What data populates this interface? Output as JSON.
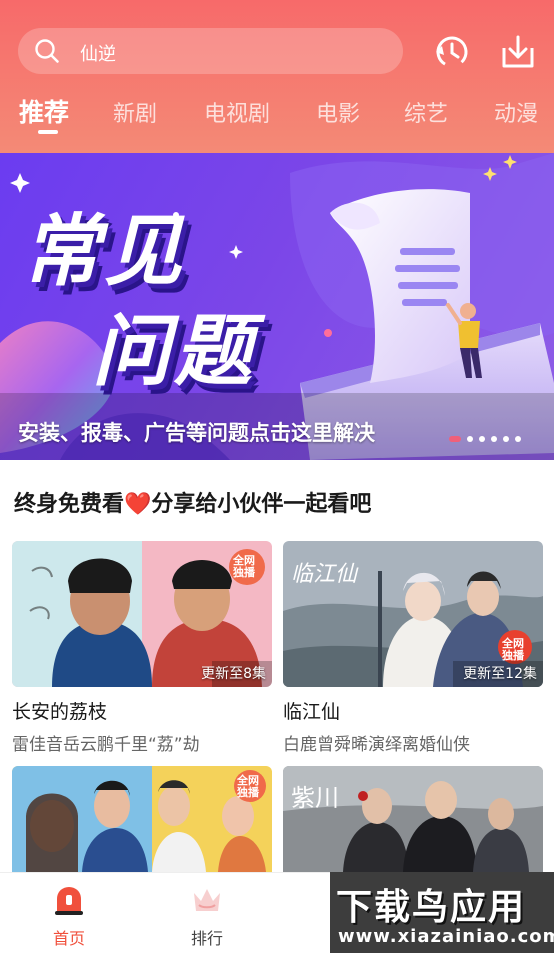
{
  "header": {
    "search_query": "仙逆",
    "icons": [
      "search-icon",
      "history-icon",
      "download-icon"
    ],
    "accent_color": "#f76a6a"
  },
  "tabs": [
    {
      "label": "推荐",
      "active": true
    },
    {
      "label": "新剧",
      "active": false
    },
    {
      "label": "电视剧",
      "active": false
    },
    {
      "label": "电影",
      "active": false
    },
    {
      "label": "综艺",
      "active": false
    },
    {
      "label": "动漫",
      "active": false
    }
  ],
  "banner": {
    "title_line1": "常见",
    "title_line2": "问题",
    "caption": "安装、报毒、广告等问题点击这里解决",
    "slide_count": 6,
    "active_slide": 1
  },
  "section": {
    "title": "终身免费看❤️分享给小伙伴一起看吧",
    "cards": [
      {
        "title": "长安的荔枝",
        "desc": "雷佳音岳云鹏千里“荔”劫",
        "update": "更新至8集",
        "badge": "全网独播"
      },
      {
        "title": "临江仙",
        "desc": "白鹿曾舜晞演绎离婚仙侠",
        "update": "更新至12集",
        "badge": "全网独播"
      },
      {
        "title": "",
        "desc": "",
        "update": "",
        "badge": "全网独播"
      },
      {
        "title": "",
        "desc": "",
        "update": "",
        "badge": ""
      }
    ]
  },
  "bottom_nav": [
    {
      "label": "首页",
      "icon": "home-icon",
      "active": true
    },
    {
      "label": "排行",
      "icon": "crown-icon",
      "active": false
    }
  ],
  "watermark": {
    "main": "下载鸟应用",
    "sub": "www.xiazainiao.com"
  }
}
